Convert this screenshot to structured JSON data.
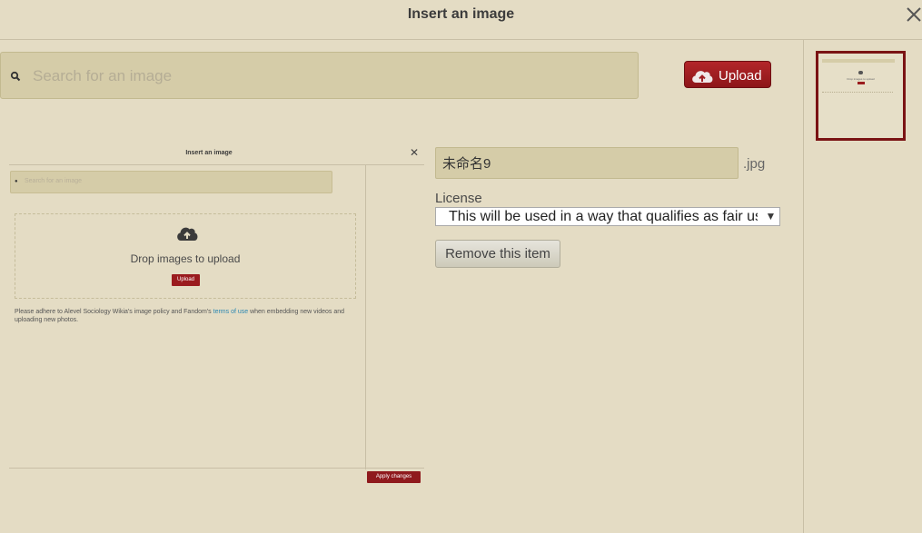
{
  "dialog": {
    "title": "Insert an image",
    "close_glyph": "✕"
  },
  "search": {
    "placeholder": "Search for an image"
  },
  "upload_button": {
    "label": "Upload"
  },
  "preview": {
    "title": "Insert an image",
    "close_glyph": "✕",
    "search_placeholder": "Search for an image",
    "drop_text": "Drop images to upload",
    "upload_label": "Upload",
    "notice_before": "Please adhere to Alevel Sociology Wikia's image policy and Fandom's ",
    "notice_link": "terms of use",
    "notice_after": " when embedding new videos and uploading new photos.",
    "apply_label": "Apply changes"
  },
  "file": {
    "name": "未命名9",
    "extension": ".jpg",
    "license_label": "License",
    "license_value": "This will be used in a way that qualifies as fair use under US law",
    "remove_label": "Remove this item"
  },
  "thumbnail": {
    "text": "Drop images to upload"
  },
  "icons": {
    "search": "search-icon",
    "close": "close-icon",
    "upload": "cloud-upload-icon",
    "dropdown": "chevron-down-icon"
  },
  "colors": {
    "background": "#e4dcc4",
    "accent": "#9a1b1e",
    "field": "#d5cca8",
    "link": "#2a87b2"
  }
}
